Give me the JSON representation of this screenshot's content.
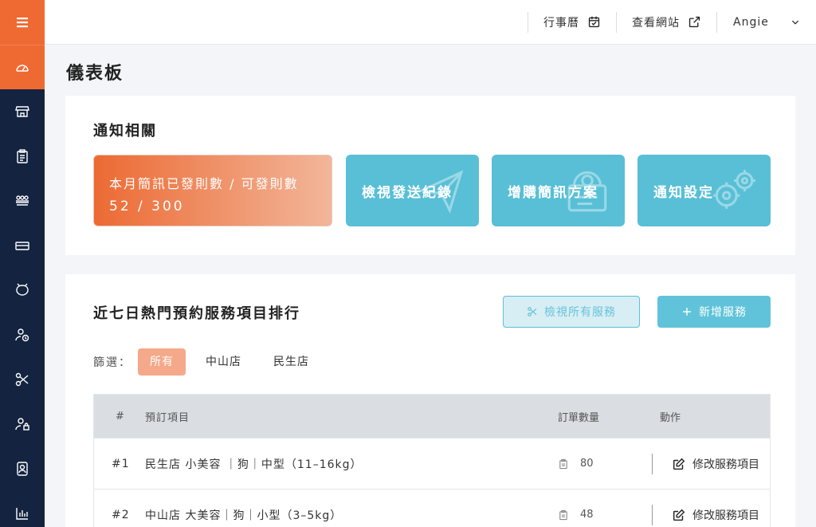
{
  "header": {
    "calendar_label": "行事曆",
    "view_site_label": "查看網站",
    "user_name": "Angie"
  },
  "page": {
    "title": "儀表板"
  },
  "notifications": {
    "title": "通知相關",
    "sms_label": "本月簡訊已發則數 / 可發則數",
    "sms_count": "52 / 300",
    "view_log_label": "檢視發送紀錄",
    "buy_plan_label": "增購簡訊方案",
    "settings_label": "通知設定"
  },
  "ranking": {
    "title": "近七日熱門預約服務項目排行",
    "view_all_label": "檢視所有服務",
    "add_label": "新增服務",
    "filter_label": "篩選：",
    "filters": [
      "所有",
      "中山店",
      "民生店"
    ],
    "columns": [
      "#",
      "預訂項目",
      "訂單數量",
      "動作"
    ],
    "rows": [
      {
        "rank": "#1",
        "item": "民生店 小美容 ｜狗｜中型（11–16kg）",
        "qty": "80",
        "action": "修改服務項目"
      },
      {
        "rank": "#2",
        "item": "中山店 大美容｜狗｜小型（3–5kg）",
        "qty": "48",
        "action": "修改服務項目"
      }
    ]
  },
  "colors": {
    "accent": "#ef6a33",
    "sidebar": "#142340",
    "teal": "#58bfd6"
  },
  "icons": [
    "menu-icon",
    "dashboard-icon",
    "store-icon",
    "clipboard-icon",
    "team-icon",
    "ticket-icon",
    "pet-icon",
    "user-clock-icon",
    "scissors-icon",
    "user-lock-icon",
    "contact-icon",
    "chart-icon"
  ]
}
